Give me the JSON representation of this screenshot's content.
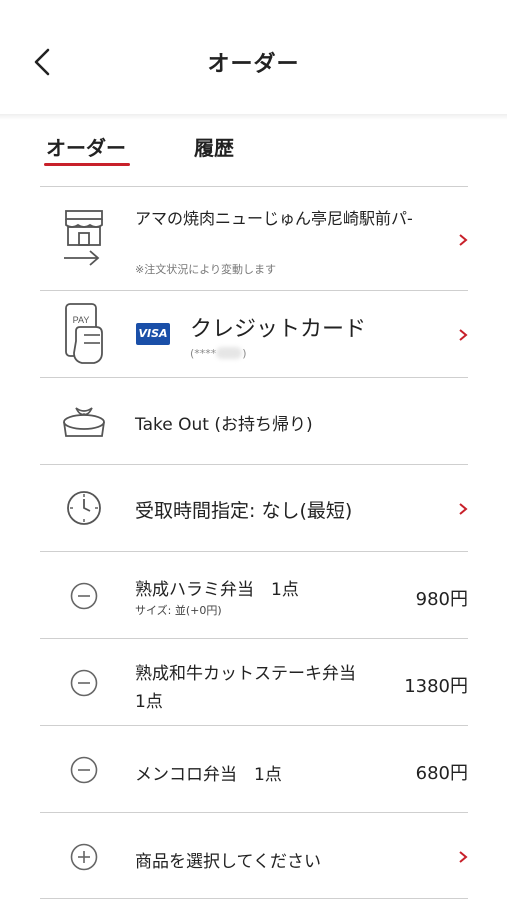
{
  "header": {
    "title": "オーダー"
  },
  "tabs": [
    {
      "label": "オーダー",
      "active": true
    },
    {
      "label": "履歴",
      "active": false
    }
  ],
  "store": {
    "name": "アマの焼肉ニューじゅん亭尼崎駅前パ-",
    "note": "※注文状況により変動します",
    "icon": "store-arrow-icon"
  },
  "payment": {
    "brand": "VISA",
    "label": "クレジットカード",
    "card_masked_prefix": "(****",
    "card_masked_suffix": ")",
    "icon": "phone-pay-icon"
  },
  "order_type": {
    "label": "Take Out (お持ち帰り)",
    "icon": "takeout-bag-icon"
  },
  "pickup": {
    "label": "受取時間指定: なし(最短)",
    "icon": "clock-icon"
  },
  "items": [
    {
      "name": "熟成ハラミ弁当　1点",
      "sub": "サイズ: 並(+0円)",
      "price": "980円"
    },
    {
      "name_line1": "熟成和牛カットステーキ弁当",
      "name_line2": "1点",
      "price": "1380円"
    },
    {
      "name": "メンコロ弁当　1点",
      "price": "680円"
    }
  ],
  "add_item": {
    "label": "商品を選択してください"
  },
  "colors": {
    "accent": "#c8202a",
    "divider": "#cfcfcf",
    "visa": "#1a4fa8"
  }
}
